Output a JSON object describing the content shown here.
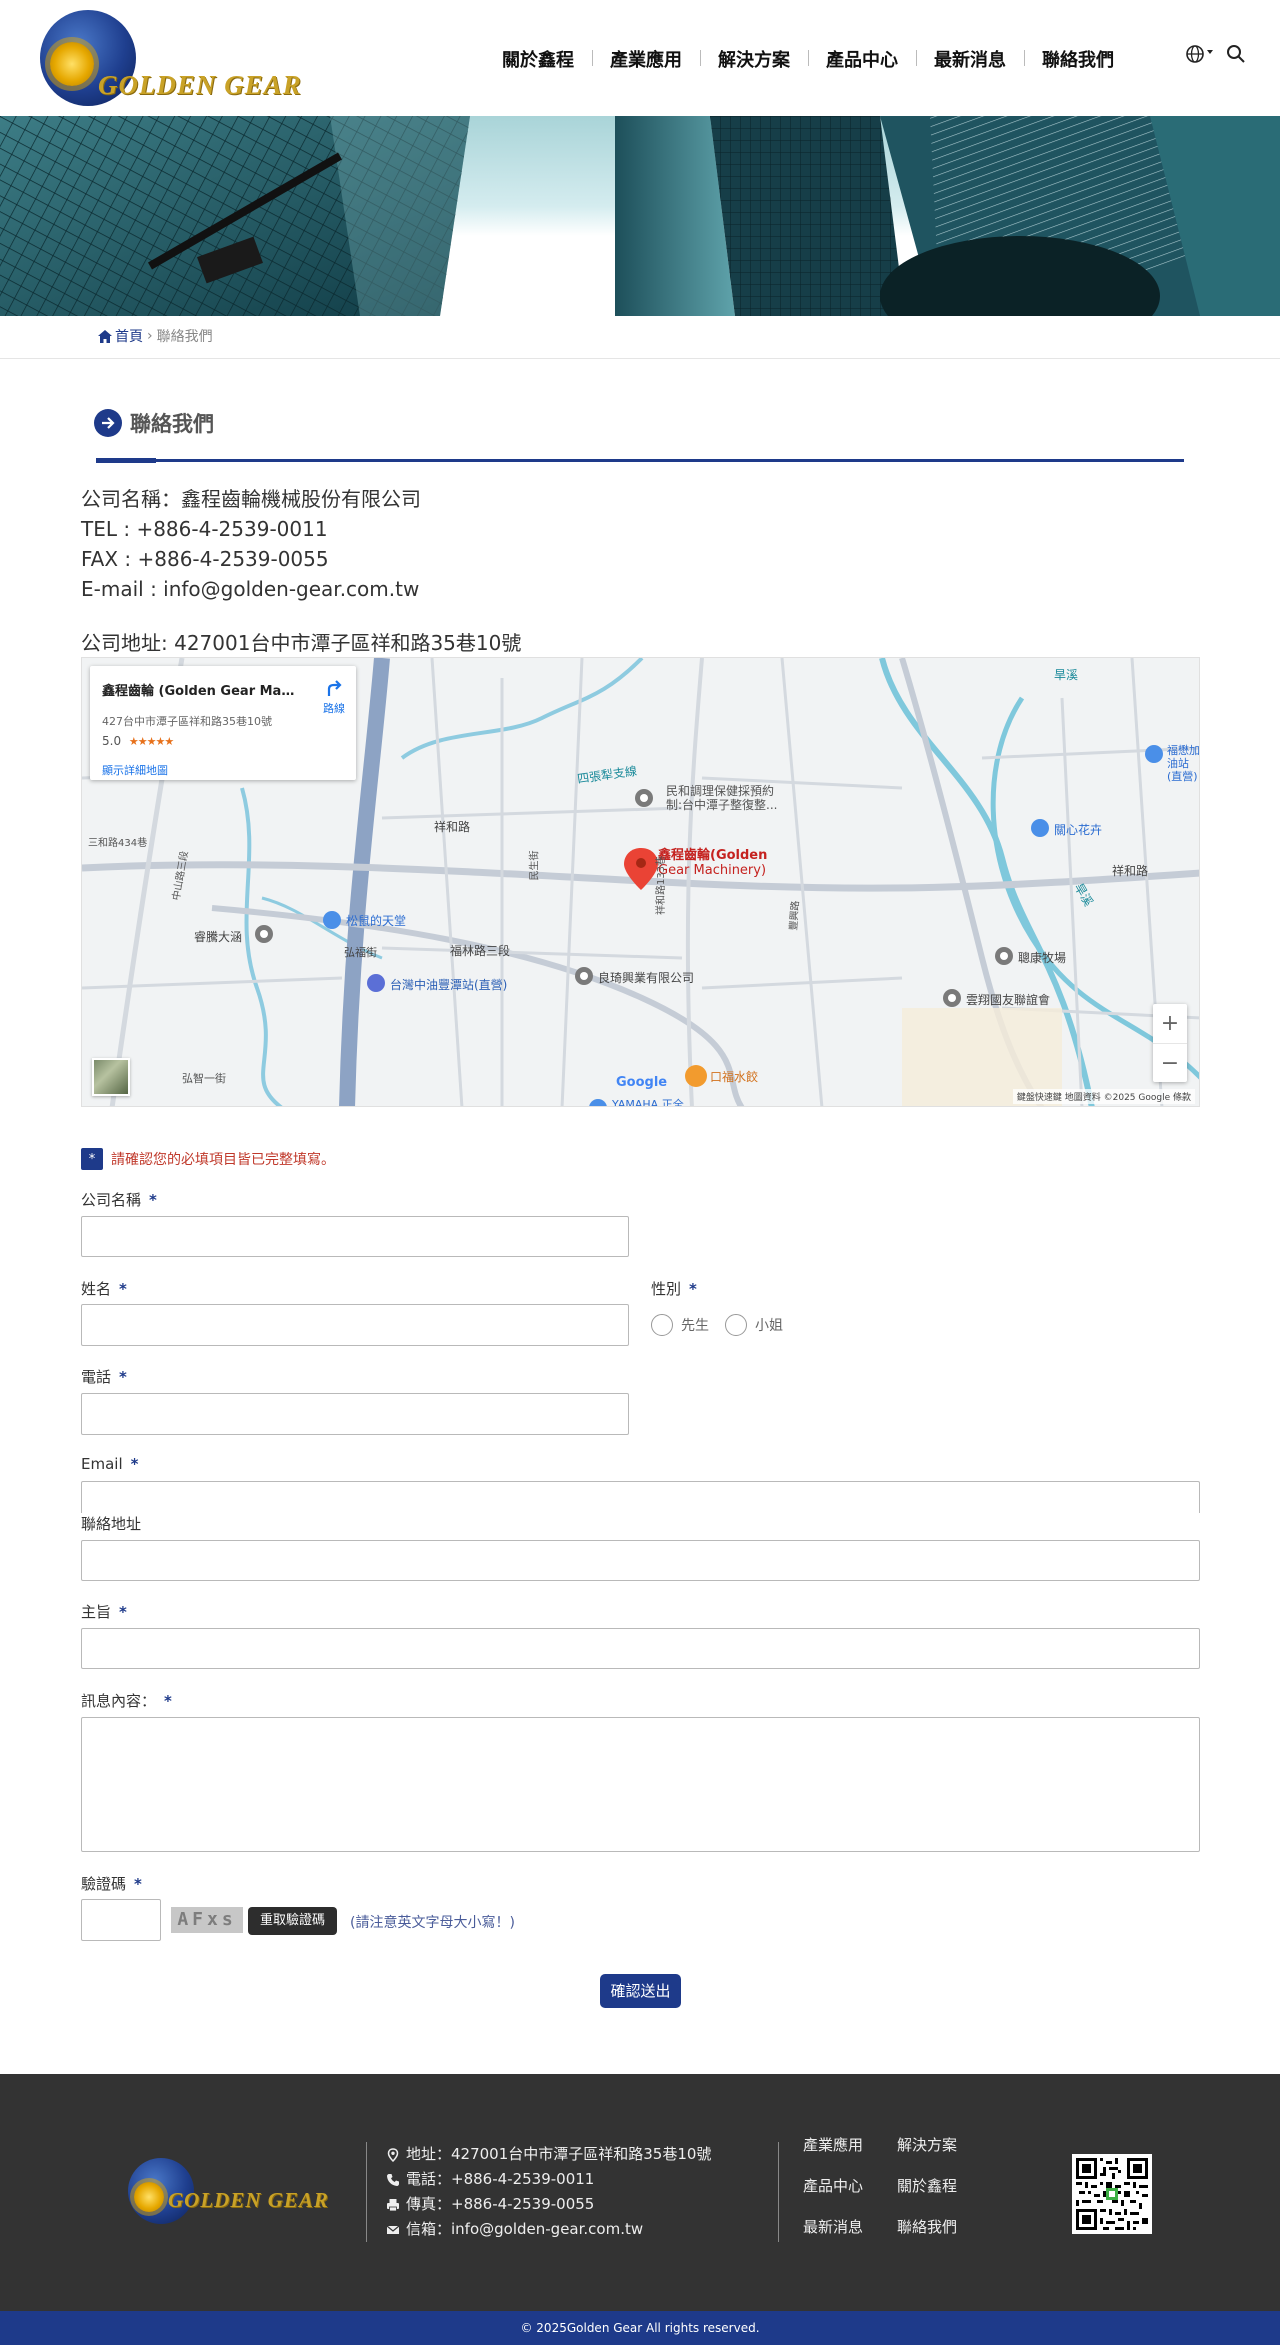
{
  "header": {
    "logo_text": "GOLDEN GEAR",
    "nav": [
      "關於鑫程",
      "產業應用",
      "解決方案",
      "產品中心",
      "最新消息",
      "聯絡我們"
    ],
    "language_icon": "globe-icon",
    "search_icon": "search-icon"
  },
  "breadcrumb": {
    "home": "首頁",
    "current": "聯絡我們"
  },
  "page_title": "聯絡我們",
  "company_info": {
    "name": "公司名稱：鑫程齒輪機械股份有限公司",
    "tel": "TEL : +886-4-2539-0011",
    "fax": "FAX : +886-4-2539-0055",
    "email": "E-mail : info@golden-gear.com.tw",
    "address": "公司地址: 427001台中市潭子區祥和路35巷10號"
  },
  "map": {
    "card_name": "鑫程齒輪 (Golden Gear Machi...",
    "card_address": "427台中市潭子區祥和路35巷10號",
    "card_rating": "5.0",
    "card_stars": "★★★★★",
    "card_more": "顯示詳細地圖",
    "card_directions": "路線",
    "pin_label_1": "鑫程齒輪(Golden",
    "pin_label_2": "Gear Machinery)",
    "places": [
      "四張犁支線",
      "民和調理保健採預約",
      "制:台中潭子整復整...",
      "祥和路",
      "松鼠的天堂",
      "睿騰大涵",
      "弘福街",
      "福林路三段",
      "台灣中油豐潭站(直營)",
      "良琦興業有限公司",
      "口福水餃",
      "YAMAHA 正全",
      "關心花卉",
      "聰康牧場",
      "雲翔國友聯誼會",
      "福懋加油站(直營)",
      "旱溪",
      "中山路三段",
      "三和路434巷",
      "弘智一街",
      "祥和路133巷",
      "民生街",
      "豐興路"
    ],
    "attribution": "鍵盤快速鍵 地圖資料 ©2025 Google 條款",
    "google": "Google",
    "zoom_in": "+",
    "zoom_out": "−"
  },
  "form": {
    "notice_icon": "*",
    "notice": "請確認您的必填項目皆已完整填寫。",
    "required_mark": "*",
    "company_label": "公司名稱",
    "name_label": "姓名",
    "gender_label": "性別",
    "gender_options": [
      "先生",
      "小姐"
    ],
    "phone_label": "電話",
    "email_label": "Email",
    "address_label": "聯絡地址",
    "subject_label": "主旨",
    "message_label": "訊息內容：",
    "captcha_label": "驗證碼",
    "captcha_image": "AFxs",
    "reload_button": "重取驗證碼",
    "captcha_hint": "(請注意英文字母大小寫！)",
    "submit": "確認送出"
  },
  "footer": {
    "logo_text": "GOLDEN GEAR",
    "address": "地址：427001台中市潭子區祥和路35巷10號",
    "phone": "電話：+886-4-2539-0011",
    "fax": "傳真：+886-4-2539-0055",
    "email": "信箱：info@golden-gear.com.tw",
    "links": [
      "產業應用",
      "解決方案",
      "產品中心",
      "關於鑫程",
      "最新消息",
      "聯絡我們"
    ],
    "copyright": "© 2025Golden Gear All rights reserved."
  },
  "colors": {
    "brand_blue": "#1e3a8a",
    "footer_bg": "#333333",
    "notice_red": "#c0392b",
    "logo_gold": "#c9a227"
  }
}
